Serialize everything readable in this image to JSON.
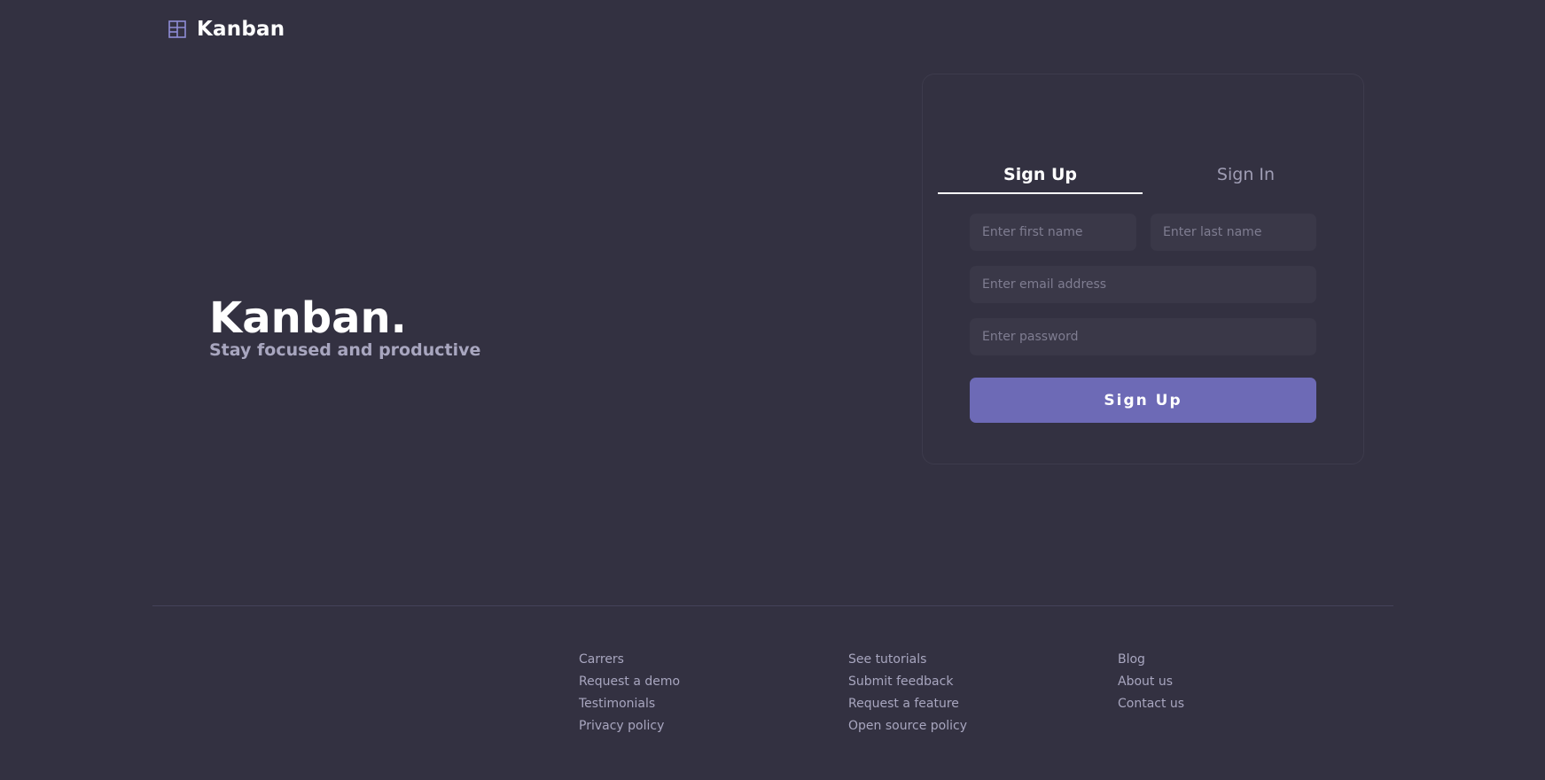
{
  "header": {
    "logo_text": "Kanban",
    "logo_icon": "board-layout-icon"
  },
  "hero": {
    "title": "Kanban.",
    "subtitle": "Stay focused and productive"
  },
  "auth": {
    "tabs": [
      {
        "label": "Sign Up",
        "active": true
      },
      {
        "label": "Sign In",
        "active": false
      }
    ],
    "fields": {
      "first_name": {
        "placeholder": "Enter first name",
        "value": ""
      },
      "last_name": {
        "placeholder": "Enter last name",
        "value": ""
      },
      "email": {
        "placeholder": "Enter email address",
        "value": ""
      },
      "password": {
        "placeholder": "Enter password",
        "value": ""
      }
    },
    "submit_label": "Sign Up"
  },
  "footer": {
    "columns": [
      {
        "links": [
          "Carrers",
          "Request a demo",
          "Testimonials",
          "Privacy policy"
        ]
      },
      {
        "links": [
          "See tutorials",
          "Submit feedback",
          "Request a feature",
          "Open source policy"
        ]
      },
      {
        "links": [
          "Blog",
          "About us",
          "Contact us"
        ]
      }
    ]
  },
  "colors": {
    "background": "#333141",
    "accent": "#6d6ab6",
    "muted_text": "#a8a6bf",
    "input_bg": "#3a3848"
  }
}
